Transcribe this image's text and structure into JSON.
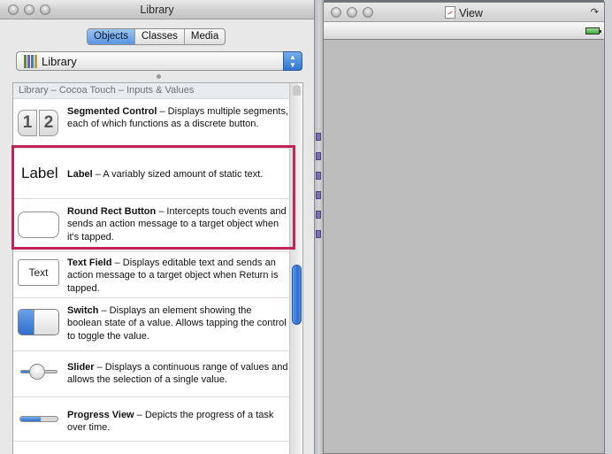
{
  "library_window": {
    "title": "Library",
    "tabs": [
      {
        "label": "Objects",
        "active": true
      },
      {
        "label": "Classes",
        "active": false
      },
      {
        "label": "Media",
        "active": false
      }
    ],
    "popup": {
      "selected": "Library",
      "icon": "library-books-icon"
    },
    "section_header": "Library – Cocoa Touch – Inputs & Values",
    "items": [
      {
        "name": "Segmented Control",
        "text": " – Displays multiple segments, each of which functions as a discrete button.",
        "thumb": {
          "a": "1",
          "b": "2"
        }
      },
      {
        "name": "Label",
        "text": " – A variably sized amount of static text.",
        "thumb": "Label"
      },
      {
        "name": "Round Rect Button",
        "text": " – Intercepts touch events and sends an action message to a target object when it's tapped."
      },
      {
        "name": "Text Field",
        "text": " – Displays editable text and sends an action message to a target object when Return is tapped.",
        "thumb": "Text"
      },
      {
        "name": "Switch",
        "text": " – Displays an element showing the boolean state of a value. Allows tapping the control to toggle the value."
      },
      {
        "name": "Slider",
        "text": " – Displays a continuous range of values and allows the selection of a single value.",
        "value": 0.45
      },
      {
        "name": "Progress View",
        "text": " – Depicts the progress of a task over time.",
        "value": 0.55
      }
    ],
    "colors": {
      "highlight": "#c1235a",
      "accent": "#2f74d0"
    }
  },
  "view_window": {
    "title": "View",
    "title_icon": "document-icon",
    "status_icon": "battery-icon"
  }
}
